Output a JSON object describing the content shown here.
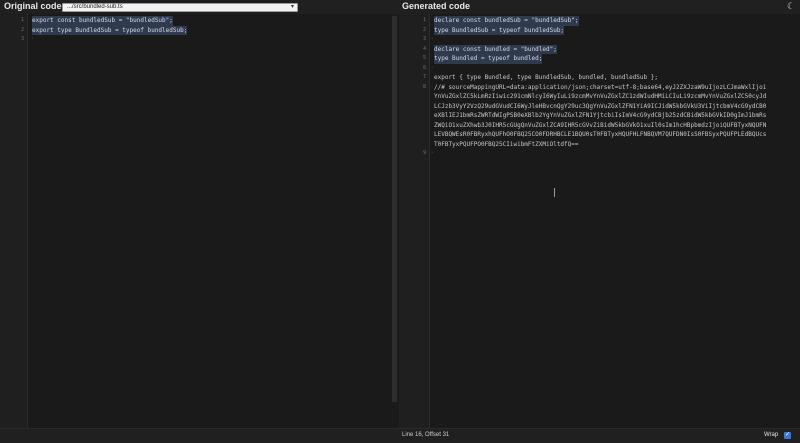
{
  "header": {
    "original_title": "Original code",
    "generated_title": "Generated code",
    "file_select_value": ".../src/bundled-sub.ts",
    "theme_icon": "moon-icon"
  },
  "left": {
    "lines": [
      {
        "num": "1",
        "text": "export const bundledSub = \"bundledSub\";",
        "hl": true
      },
      {
        "num": "2",
        "text": "export type BundledSub = typeof bundledSub;",
        "hl": true
      },
      {
        "num": "3",
        "text": "",
        "hl": false
      }
    ]
  },
  "right": {
    "lines": [
      {
        "num": "1",
        "text": "declare const bundledSub = \"bundledSub\";",
        "hl": true
      },
      {
        "num": "2",
        "text": "type BundledSub = typeof bundledSub;",
        "hl": true
      },
      {
        "num": "3",
        "text": "",
        "hl": false
      },
      {
        "num": "4",
        "text": "declare const bundled = \"bundled\";",
        "hl": true
      },
      {
        "num": "5",
        "text": "type Bundled = typeof bundled;",
        "hl": true
      },
      {
        "num": "6",
        "text": "",
        "hl": false
      },
      {
        "num": "7",
        "text": "export { type Bundled, type BundledSub, bundled, bundledSub };",
        "hl": false
      },
      {
        "num": "8",
        "text": "//# sourceMappingURL=data:application/json;charset=utf-8;base64,eyJ2ZXJzaW9uIjozLCJmaWxlIjoi",
        "hl": false
      },
      {
        "num": "",
        "text": "YnVuZGxlZC5kLmRzIiwic291cmNlcyI6WyIuLi9zcmMvYnVuZGxlZC1zdWIudHMiLCIuLi9zcmMvYnVuZGxlZC50cyJd",
        "hl": false
      },
      {
        "num": "",
        "text": "LCJzb3VyY2VzQ29udGVudCI6WyJleHBvcnQgY29uc3QgYnVuZGxlZFN1YiA9ICJidW5kbGVkU3ViIjtcbmV4cG9ydCB0",
        "hl": false
      },
      {
        "num": "",
        "text": "eXBlIEJ1bmRsZWRTdWIgPSB0eXBlb2YgYnVuZGxlZFN1YjtcbiIsImV4cG9ydCBjb25zdCBidW5kbGVkID0gImJ1bmRs",
        "hl": false
      },
      {
        "num": "",
        "text": "ZWQiO1xuZXhwb3J0IHR5cGUgQnVuZGxlZCA9IHR5cGVvZiBidW5kbGVkO1xuIl0sIm1hcHBpbmdzIjoiQUFBTyxNQUFN",
        "hl": false
      },
      {
        "num": "",
        "text": "LEVBQWEsR0FBRyxhQUFhO0FBQ25CO0FDRHBCLE1BQU0sT0FBTyxHQUFHLFNBQVM7QUFDN0IsS0FBSyxPQUFPLEdBQUcs",
        "hl": false
      },
      {
        "num": "",
        "text": "T0FBTyxPQUFPO0FBQ25CIiwibmFtZXMiOltdfQ==",
        "hl": false
      },
      {
        "num": "9",
        "text": "",
        "hl": false
      }
    ]
  },
  "status": {
    "position": "Line 16, Offset 31",
    "wrap_label": "Wrap",
    "wrap_checked": "✓"
  },
  "colors": {
    "background": "#1a1a1a",
    "highlight": "#2f3a4e",
    "accent": "#3a78d8"
  }
}
